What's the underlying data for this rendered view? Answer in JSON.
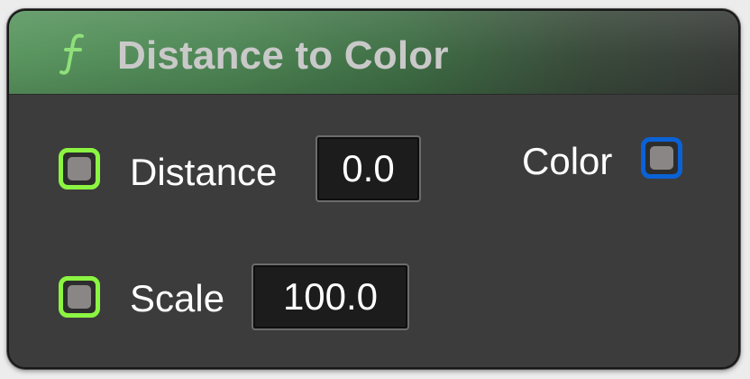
{
  "node": {
    "title": "Distance to Color",
    "icon": "function-icon",
    "colors": {
      "header_green": "#5a9660",
      "body": "#3c3c3c",
      "input_pin": "#8bf542",
      "output_pin": "#0b62d6"
    }
  },
  "inputs": [
    {
      "label": "Distance",
      "value": "0.0"
    },
    {
      "label": "Scale",
      "value": "100.0"
    }
  ],
  "outputs": [
    {
      "label": "Color"
    }
  ]
}
